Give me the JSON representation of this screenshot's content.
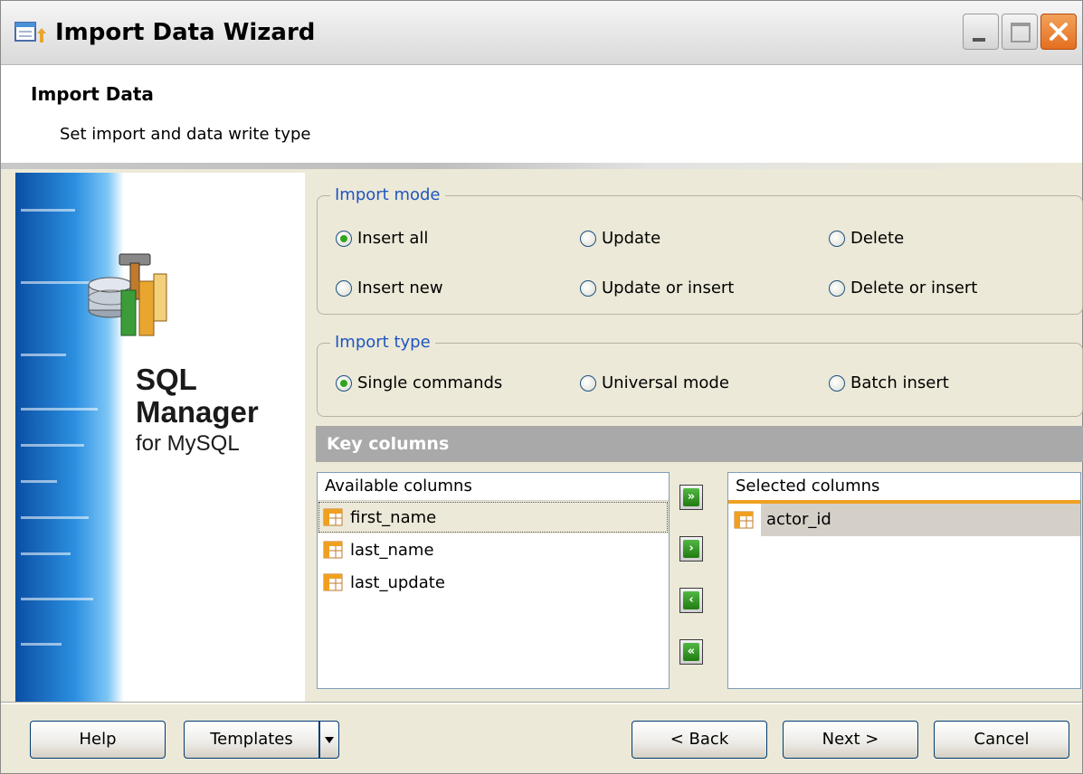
{
  "window": {
    "title": "Import Data Wizard"
  },
  "header": {
    "title": "Import Data",
    "subtitle": "Set import and data write type"
  },
  "banner": {
    "brand_line1": "SQL",
    "brand_line2": "Manager",
    "brand_line3": "for MySQL"
  },
  "import_mode": {
    "legend": "Import mode",
    "options": [
      {
        "label": "Insert all",
        "checked": true
      },
      {
        "label": "Update",
        "checked": false
      },
      {
        "label": "Delete",
        "checked": false
      },
      {
        "label": "Insert new",
        "checked": false
      },
      {
        "label": "Update or insert",
        "checked": false
      },
      {
        "label": "Delete or insert",
        "checked": false
      }
    ]
  },
  "import_type": {
    "legend": "Import type",
    "options": [
      {
        "label": "Single commands",
        "checked": true
      },
      {
        "label": "Universal mode",
        "checked": false
      },
      {
        "label": "Batch insert",
        "checked": false
      }
    ]
  },
  "key_columns": {
    "title": "Key columns",
    "available_header": "Available columns",
    "available": [
      "first_name",
      "last_name",
      "last_update"
    ],
    "selected_header": "Selected columns",
    "selected": [
      "actor_id"
    ],
    "move_buttons": [
      "move-all-right",
      "move-right",
      "move-left",
      "move-all-left"
    ]
  },
  "buttons": {
    "help": "Help",
    "templates": "Templates",
    "back": "< Back",
    "next": "Next >",
    "cancel": "Cancel"
  },
  "colors": {
    "legend_blue": "#1f56c0",
    "key_bar": "#a9a9a9",
    "accent_orange": "#f0a020"
  }
}
